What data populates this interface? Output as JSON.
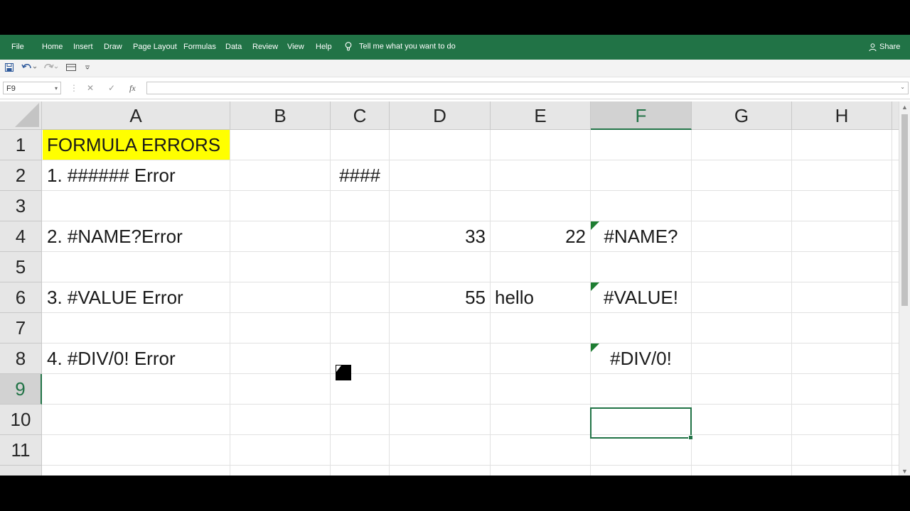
{
  "ribbon": {
    "tabs": [
      "File",
      "Home",
      "Insert",
      "Draw",
      "Page Layout",
      "Formulas",
      "Data",
      "Review",
      "View",
      "Help"
    ],
    "tell_me": "Tell me what you want to do",
    "share": "Share",
    "tell_icon": "lightbulb-icon",
    "share_icon": "person-icon"
  },
  "quick_access": {
    "icons": [
      "save-icon",
      "undo-icon",
      "redo-icon",
      "form-icon",
      "customize-icon"
    ]
  },
  "formula_bar": {
    "name_box": "F9",
    "formula": "",
    "icons": [
      "cancel-icon",
      "enter-icon",
      "function-icon"
    ],
    "fx": "fx"
  },
  "grid": {
    "columns": [
      "A",
      "B",
      "C",
      "D",
      "E",
      "F",
      "G",
      "H"
    ],
    "selected_column": "F",
    "rows": [
      "1",
      "2",
      "3",
      "4",
      "5",
      "6",
      "7",
      "8",
      "9",
      "10",
      "11"
    ],
    "selected_row": "9",
    "cells": {
      "A1": "FORMULA ERRORS",
      "A2": "1. ###### Error",
      "C2": "####",
      "A4": "2. #NAME?Error",
      "D4": "33",
      "E4": "22",
      "F4": "#NAME?",
      "A6": "3. #VALUE Error",
      "D6": "55",
      "E6": "hello",
      "F6": "#VALUE!",
      "A8": "4. #DIV/0! Error",
      "F8": "#DIV/0!"
    },
    "highlight_color": "#ffff00",
    "error_indicator_color": "#1e7d32"
  },
  "colors": {
    "ribbon": "#217346",
    "accent": "#217346"
  }
}
